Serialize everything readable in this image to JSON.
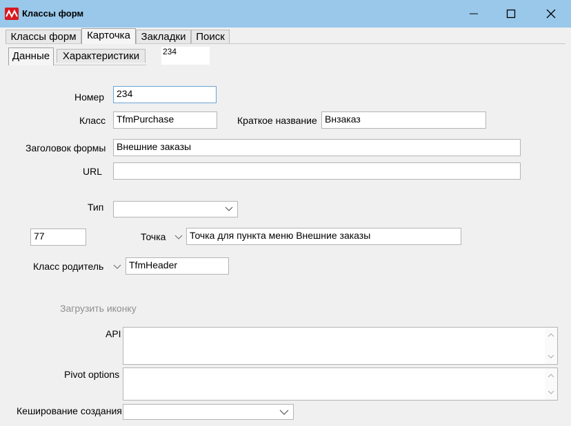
{
  "window": {
    "title": "Классы форм",
    "controls": {
      "minimize": "minimize-icon",
      "maximize": "maximize-icon",
      "close": "close-icon"
    }
  },
  "main_tabs": [
    {
      "label": "Классы форм"
    },
    {
      "label": "Карточка"
    },
    {
      "label": "Закладки"
    },
    {
      "label": "Поиск"
    }
  ],
  "sub_tabs": [
    {
      "label": "Данные"
    },
    {
      "label": "Характеристики"
    }
  ],
  "record_id": "234",
  "form": {
    "number_label": "Номер",
    "number_value": "234",
    "class_label": "Класс",
    "class_value": "TfmPurchase",
    "short_name_label": "Краткое название",
    "short_name_value": "Внзаказ",
    "form_title_label": "Заголовок формы",
    "form_title_value": "Внешние заказы",
    "url_label": "URL",
    "url_value": "",
    "type_label": "Тип",
    "type_value": "",
    "point_code_value": "77",
    "point_label": "Точка",
    "point_value": "Точка для пункта меню Внешние заказы",
    "parent_label": "Класс родитель",
    "parent_value": "TfmHeader",
    "load_icon_label": "Загрузить иконку",
    "api_label": "API",
    "pivot_label": "Pivot options",
    "cache_label": "Кеширование создания",
    "cache_value": ""
  }
}
